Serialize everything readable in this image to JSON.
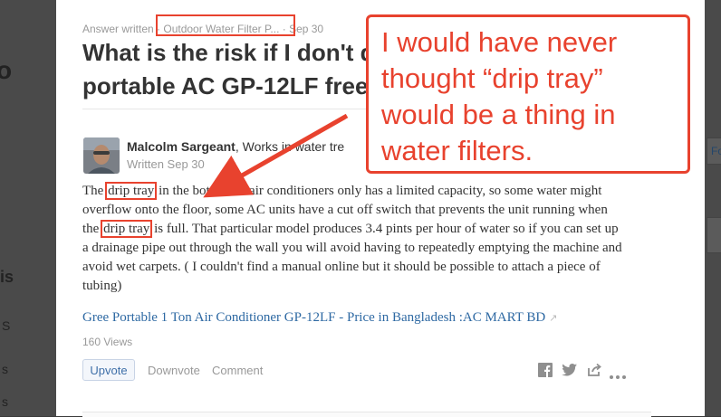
{
  "background": {
    "left_letters": [
      "o",
      "is",
      "S",
      "s",
      "s"
    ],
    "right_tab_label": "Fo"
  },
  "answer_page": {
    "meta_prefix": "Answer written · ",
    "topic": "Outdoor Water Filter P...",
    "meta_suffix": " · Sep 30",
    "question_line1": "What is the risk if I don't d",
    "question_line2": "portable AC GP-12LF free",
    "author_name": "Malcolm Sargeant",
    "author_credential": ", Works in water tre",
    "written_date": "Written Sep 30",
    "answer_parts": [
      "The ",
      "drip tray",
      " in the bottom of air conditioners only has a limited capacity, so some water might overflow onto the floor, some AC units have a cut off switch that prevents the unit running when the ",
      "drip tray",
      " is full. That particular model produces 3.4 pints per hour of water so if you can set up a drainage pipe out through the wall you will avoid having to repeatedly emptying the machine and avoid wet carpets. ( I couldn't find a manual online but it should be possible to attach a piece of tubing)"
    ],
    "link_text": "Gree Portable 1 Ton Air Conditioner GP-12LF - Price in Bangladesh :AC MART BD",
    "views": "160 Views",
    "upvote_label": "Upvote",
    "downvote_label": "Downvote",
    "comment_label": "Comment",
    "share_icons": [
      "facebook-icon",
      "twitter-icon",
      "share-icon",
      "more-icon"
    ]
  },
  "annotation": {
    "callout_text": "I would have never thought “drip tray” would be a thing in water filters.",
    "color": "#e8422e"
  },
  "colors": {
    "link": "#2e69a3",
    "upvote": "#3e6fa8",
    "muted": "#999999",
    "text": "#333333"
  }
}
